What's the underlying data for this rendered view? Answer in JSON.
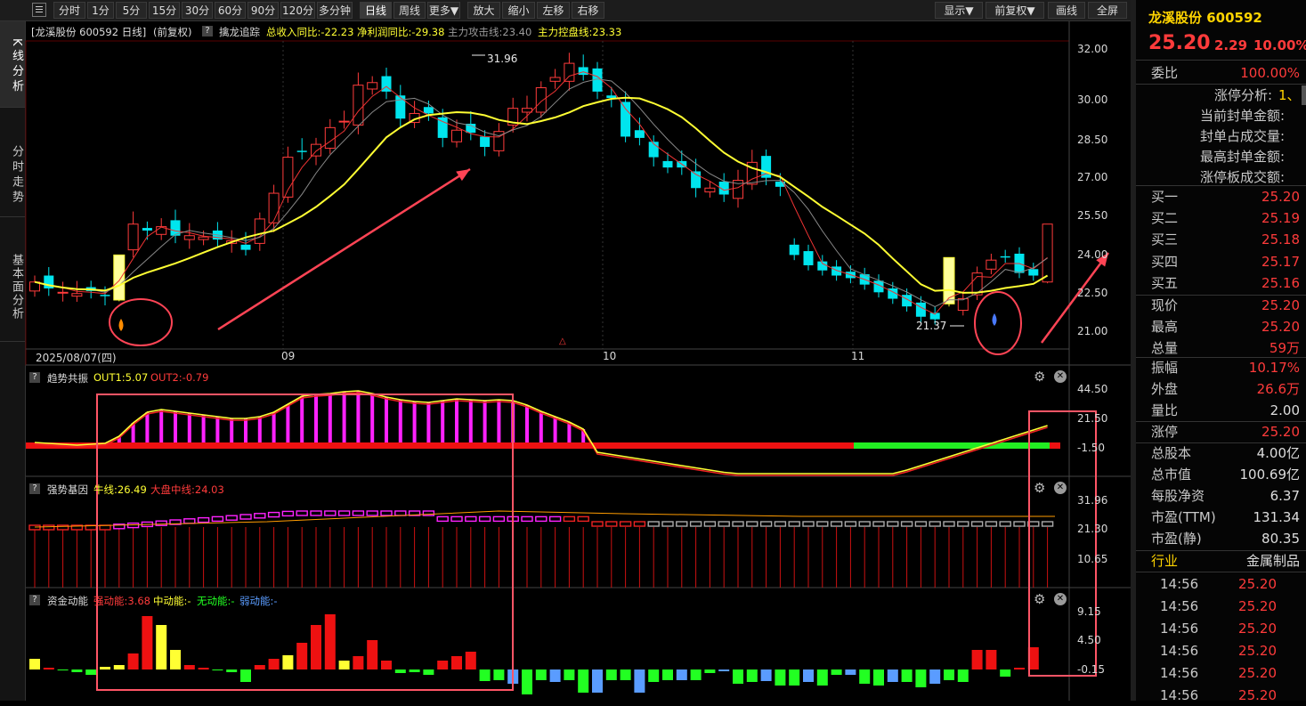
{
  "toolbar": {
    "left": [
      "分时",
      "1分",
      "5分",
      "15分",
      "30分",
      "60分",
      "90分",
      "120分",
      "多分钟",
      "日线",
      "周线",
      "更多▼",
      "放大",
      "缩小",
      "左移",
      "右移"
    ],
    "right": [
      "显示▼",
      "前复权▼",
      "画线",
      "全屏"
    ],
    "active": "日线"
  },
  "nav": {
    "tabs": [
      "K线分析",
      "分时走势",
      "基本面分析"
    ]
  },
  "main": {
    "info": {
      "stock": "[龙溪股份 600592 日线]",
      "adj": "(前复权)",
      "indicator": "擒龙追踪",
      "v1": "总收入同比:-22.23",
      "v2": "净利润同比:-29.38",
      "v3": "主力攻击线:23.40",
      "v4": "主力控盘线:23.33"
    },
    "yaxis": [
      "32.00",
      "30.00",
      "28.50",
      "27.00",
      "25.50",
      "24.00",
      "22.50",
      "21.00"
    ],
    "high_label": "31.96",
    "low_label": "21.37",
    "xlabels": [
      "2025/08/07(四)",
      "09",
      "10",
      "11"
    ]
  },
  "p1": {
    "name": "趋势共振",
    "out1": "OUT1:5.07",
    "out2": "OUT2:-0.79",
    "yaxis": [
      "44.50",
      "21.50",
      "-1.50"
    ]
  },
  "p2": {
    "name": "强势基因",
    "l1": "牛线:26.49",
    "l2": "大盘中线:24.03",
    "yaxis": [
      "31.96",
      "21.30",
      "10.65"
    ]
  },
  "p3": {
    "name": "资金动能",
    "l1": "强动能:3.68",
    "l2": "中动能:-",
    "l3": "无动能:-",
    "l4": "弱动能:-",
    "yaxis": [
      "9.15",
      "4.50",
      "-0.15"
    ]
  },
  "right": {
    "title": "龙溪股份 600592",
    "price": "25.20",
    "change": "2.29",
    "pct": "10.00%",
    "wb_label": "委比",
    "wb_value": "100.00%",
    "zt": [
      "涨停分析:",
      "当前封单金额:",
      "封单占成交量:",
      "最高封单金额:",
      "涨停板成交额:"
    ],
    "zt_extra": "1、",
    "bids": [
      {
        "l": "买一",
        "v": "25.20"
      },
      {
        "l": "买二",
        "v": "25.19"
      },
      {
        "l": "买三",
        "v": "25.18"
      },
      {
        "l": "买四",
        "v": "25.17"
      },
      {
        "l": "买五",
        "v": "25.16"
      }
    ],
    "s1": [
      {
        "l": "现价",
        "v": "25.20"
      },
      {
        "l": "最高",
        "v": "25.20"
      },
      {
        "l": "总量",
        "v": "59万"
      }
    ],
    "s2": [
      {
        "l": "振幅",
        "v": "10.17%"
      },
      {
        "l": "外盘",
        "v": "26.6万"
      },
      {
        "l": "量比",
        "v": "2.00"
      }
    ],
    "s3": [
      {
        "l": "涨停",
        "v": "25.20"
      }
    ],
    "s4": [
      {
        "l": "总股本",
        "v": "4.00亿"
      },
      {
        "l": "总市值",
        "v": "100.69亿"
      },
      {
        "l": "每股净资",
        "v": "6.37"
      },
      {
        "l": "市盈(TTM)",
        "v": "131.34"
      },
      {
        "l": "市盈(静)",
        "v": "80.35"
      }
    ],
    "industry_l": "行业",
    "industry_v": "金属制品",
    "ticks": [
      {
        "t": "14:56",
        "p": "25.20"
      },
      {
        "t": "14:56",
        "p": "25.20"
      },
      {
        "t": "14:56",
        "p": "25.20"
      },
      {
        "t": "14:56",
        "p": "25.20"
      },
      {
        "t": "14:56",
        "p": "25.20"
      },
      {
        "t": "14:56",
        "p": "25.20"
      }
    ]
  },
  "colors": {
    "up": "#ff3b3b",
    "down": "#00e5ee",
    "yellow": "#ffff33",
    "magenta": "#ff22ff",
    "green": "#22ff22",
    "blue": "#5a9cff"
  }
}
